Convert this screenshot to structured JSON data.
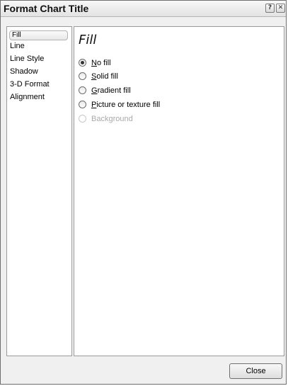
{
  "window": {
    "title": "Format Chart Title",
    "help_glyph": "?",
    "close_glyph": "✕"
  },
  "sidebar": {
    "items": [
      {
        "label": "Fill",
        "selected": true
      },
      {
        "label": "Line",
        "selected": false
      },
      {
        "label": "Line Style",
        "selected": false
      },
      {
        "label": "Shadow",
        "selected": false
      },
      {
        "label": "3-D Format",
        "selected": false
      },
      {
        "label": "Alignment",
        "selected": false
      }
    ]
  },
  "panel": {
    "heading": "Fill",
    "options": [
      {
        "key": "N",
        "rest": "o fill",
        "checked": true,
        "enabled": true
      },
      {
        "key": "S",
        "rest": "olid fill",
        "checked": false,
        "enabled": true
      },
      {
        "key": "G",
        "rest": "radient fill",
        "checked": false,
        "enabled": true
      },
      {
        "key": "P",
        "rest": "icture or texture fill",
        "checked": false,
        "enabled": true
      },
      {
        "key": "",
        "rest": "Background",
        "checked": false,
        "enabled": false
      }
    ]
  },
  "footer": {
    "close_label": "Close"
  }
}
